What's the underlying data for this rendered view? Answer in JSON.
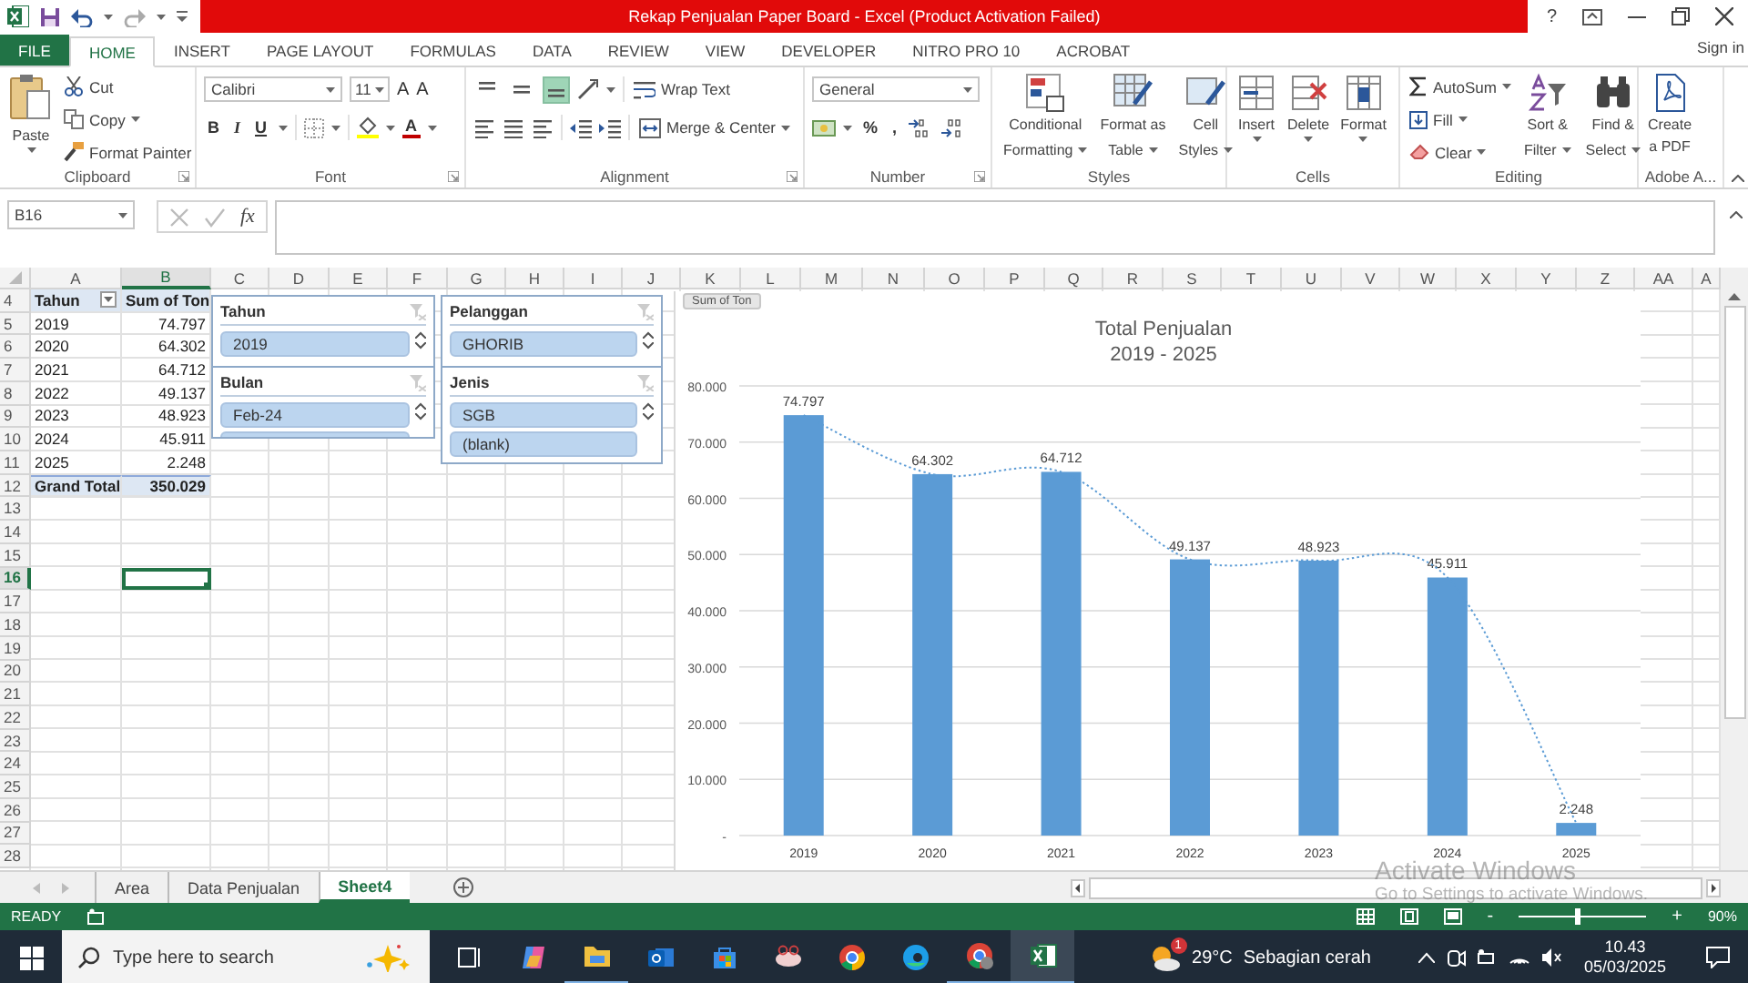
{
  "title_bar": {
    "title": "Rekap Penjualan Paper Board -  Excel (Product Activation Failed)",
    "help": "?"
  },
  "ribbon_tabs": [
    {
      "label": "FILE",
      "kind": "file",
      "selected": false
    },
    {
      "label": "HOME",
      "kind": "tab",
      "selected": true
    },
    {
      "label": "INSERT",
      "kind": "tab",
      "selected": false
    },
    {
      "label": "PAGE LAYOUT",
      "kind": "tab",
      "selected": false
    },
    {
      "label": "FORMULAS",
      "kind": "tab",
      "selected": false
    },
    {
      "label": "DATA",
      "kind": "tab",
      "selected": false
    },
    {
      "label": "REVIEW",
      "kind": "tab",
      "selected": false
    },
    {
      "label": "VIEW",
      "kind": "tab",
      "selected": false
    },
    {
      "label": "DEVELOPER",
      "kind": "tab",
      "selected": false
    },
    {
      "label": "NITRO PRO 10",
      "kind": "tab",
      "selected": false
    },
    {
      "label": "ACROBAT",
      "kind": "tab",
      "selected": false
    }
  ],
  "sign_in": "Sign in",
  "ribbon": {
    "clipboard": {
      "label": "Clipboard",
      "paste": "Paste",
      "cut": "Cut",
      "copy": "Copy",
      "format_painter": "Format Painter"
    },
    "font": {
      "label": "Font",
      "name": "Calibri",
      "size": "11",
      "grow": "A",
      "shrink": "A",
      "bold": "B",
      "italic": "I",
      "underline": "U",
      "font_color": "A"
    },
    "alignment": {
      "label": "Alignment",
      "vertical": [
        {
          "kind": "top",
          "selected": false
        },
        {
          "kind": "middle",
          "selected": false
        },
        {
          "kind": "bottom",
          "selected": true
        }
      ],
      "wrap_text": "Wrap Text",
      "merge": "Merge & Center"
    },
    "number": {
      "label": "Number",
      "format": "General",
      "percent": "%",
      "comma": ","
    },
    "styles": {
      "label": "Styles",
      "buttons": [
        {
          "kind": "conditional",
          "lines": [
            "Conditional",
            "Formatting"
          ]
        },
        {
          "kind": "table",
          "lines": [
            "Format as",
            "Table"
          ]
        },
        {
          "kind": "cell",
          "lines": [
            "Cell",
            "Styles"
          ]
        }
      ]
    },
    "cells": {
      "label": "Cells",
      "buttons": [
        {
          "kind": "insert",
          "label": "Insert"
        },
        {
          "kind": "delete",
          "label": "Delete"
        },
        {
          "kind": "format",
          "label": "Format"
        }
      ]
    },
    "editing": {
      "label": "Editing",
      "autosum": "AutoSum",
      "fill": "Fill",
      "clear": "Clear",
      "buttons": [
        {
          "kind": "sort",
          "lines": [
            "Sort &",
            "Filter"
          ]
        },
        {
          "kind": "find",
          "lines": [
            "Find &",
            "Select"
          ]
        }
      ]
    },
    "adobe": {
      "label": "Adobe A...",
      "lines": [
        "Create",
        "a PDF"
      ]
    }
  },
  "formula_bar": {
    "name_box": "B16",
    "function_label": "fx"
  },
  "sheet": {
    "columns": [
      {
        "label": "A",
        "selected": false
      },
      {
        "label": "B",
        "selected": true
      },
      {
        "label": "C",
        "selected": false
      },
      {
        "label": "D",
        "selected": false
      },
      {
        "label": "E",
        "selected": false
      },
      {
        "label": "F",
        "selected": false
      },
      {
        "label": "G",
        "selected": false
      },
      {
        "label": "H",
        "selected": false
      },
      {
        "label": "I",
        "selected": false
      },
      {
        "label": "J",
        "selected": false
      },
      {
        "label": "K",
        "selected": false
      },
      {
        "label": "L",
        "selected": false
      },
      {
        "label": "M",
        "selected": false
      },
      {
        "label": "N",
        "selected": false
      },
      {
        "label": "O",
        "selected": false
      },
      {
        "label": "P",
        "selected": false
      },
      {
        "label": "Q",
        "selected": false
      },
      {
        "label": "R",
        "selected": false
      },
      {
        "label": "S",
        "selected": false
      },
      {
        "label": "T",
        "selected": false
      },
      {
        "label": "U",
        "selected": false
      },
      {
        "label": "V",
        "selected": false
      },
      {
        "label": "W",
        "selected": false
      },
      {
        "label": "X",
        "selected": false
      },
      {
        "label": "Y",
        "selected": false
      },
      {
        "label": "Z",
        "selected": false
      },
      {
        "label": "AA",
        "selected": false
      },
      {
        "label": "A",
        "selected": false
      }
    ],
    "rows": [
      {
        "label": "4",
        "selected": false
      },
      {
        "label": "5",
        "selected": false
      },
      {
        "label": "6",
        "selected": false
      },
      {
        "label": "7",
        "selected": false
      },
      {
        "label": "8",
        "selected": false
      },
      {
        "label": "9",
        "selected": false
      },
      {
        "label": "10",
        "selected": false
      },
      {
        "label": "11",
        "selected": false
      },
      {
        "label": "12",
        "selected": false
      },
      {
        "label": "13",
        "selected": false
      },
      {
        "label": "14",
        "selected": false
      },
      {
        "label": "15",
        "selected": false
      },
      {
        "label": "16",
        "selected": true
      },
      {
        "label": "17",
        "selected": false
      },
      {
        "label": "18",
        "selected": false
      },
      {
        "label": "19",
        "selected": false
      },
      {
        "label": "20",
        "selected": false
      },
      {
        "label": "21",
        "selected": false
      },
      {
        "label": "22",
        "selected": false
      },
      {
        "label": "23",
        "selected": false
      },
      {
        "label": "24",
        "selected": false
      },
      {
        "label": "25",
        "selected": false
      },
      {
        "label": "26",
        "selected": false
      },
      {
        "label": "27",
        "selected": false
      },
      {
        "label": "28",
        "selected": false
      }
    ],
    "pivot": {
      "row_header": "Tahun",
      "value_header": "Sum of Ton",
      "rows": [
        {
          "label": "2019",
          "value": "74.797"
        },
        {
          "label": "2020",
          "value": "64.302"
        },
        {
          "label": "2021",
          "value": "64.712"
        },
        {
          "label": "2022",
          "value": "49.137"
        },
        {
          "label": "2023",
          "value": "48.923"
        },
        {
          "label": "2024",
          "value": "45.911"
        },
        {
          "label": "2025",
          "value": "2.248"
        }
      ],
      "total": {
        "label": "Grand Total",
        "value": "350.029"
      }
    }
  },
  "slicers": [
    {
      "title": "Tahun",
      "items": [
        {
          "label": "2019",
          "selected": true
        }
      ],
      "more_below": false
    },
    {
      "title": "Bulan",
      "items": [
        {
          "label": "Feb-24",
          "selected": true
        }
      ],
      "more_below": true
    },
    {
      "title": "Pelanggan",
      "items": [
        {
          "label": "GHORIB",
          "selected": true
        }
      ],
      "more_below": false
    },
    {
      "title": "Jenis",
      "items": [
        {
          "label": "SGB",
          "selected": true
        },
        {
          "label": "(blank)",
          "selected": true
        }
      ],
      "more_below": false
    }
  ],
  "chart": {
    "trendline": true,
    "title_lines": [
      "Total Penjualan",
      "2019 - 2025"
    ],
    "chart_data": {
      "type": "bar",
      "categories": [
        "2019",
        "2020",
        "2021",
        "2022",
        "2023",
        "2024",
        "2025"
      ],
      "series": [
        {
          "name": "Sum of Ton",
          "color": "#5b9bd5",
          "values": [
            74.797,
            64.302,
            64.712,
            49.137,
            48.923,
            45.911,
            2.248
          ]
        }
      ],
      "ylim": [
        0,
        80
      ],
      "yticks": [
        {
          "value": 0,
          "label": "-"
        },
        {
          "value": 10,
          "label": "10.000"
        },
        {
          "value": 20,
          "label": "20.000"
        },
        {
          "value": 30,
          "label": "30.000"
        },
        {
          "value": 40,
          "label": "40.000"
        },
        {
          "value": 50,
          "label": "50.000"
        },
        {
          "value": 60,
          "label": "60.000"
        },
        {
          "value": 70,
          "label": "70.000"
        },
        {
          "value": 80,
          "label": "80.000"
        }
      ],
      "value_labels": [
        "74.797",
        "64.302",
        "64.712",
        "49.137",
        "48.923",
        "45.911",
        "2.248"
      ],
      "grid": true
    }
  },
  "activation_notice": [
    "Activate Windows",
    "Go to Settings to activate Windows."
  ],
  "sheet_tabs": [
    {
      "label": "Area",
      "selected": false
    },
    {
      "label": "Data Penjualan",
      "selected": false
    },
    {
      "label": "Sheet4",
      "selected": true
    }
  ],
  "status_bar": {
    "status": "READY",
    "zoom_out": "-",
    "zoom_in": "+",
    "zoom": {
      "level": 0.45,
      "reading": "90%"
    }
  },
  "taskbar": {
    "search_placeholder": "Type here to search",
    "weather": {
      "temperature": "29°C",
      "condition": "Sebagian cerah",
      "badge": "1"
    },
    "time": "10.43",
    "date": "05/03/2025"
  }
}
